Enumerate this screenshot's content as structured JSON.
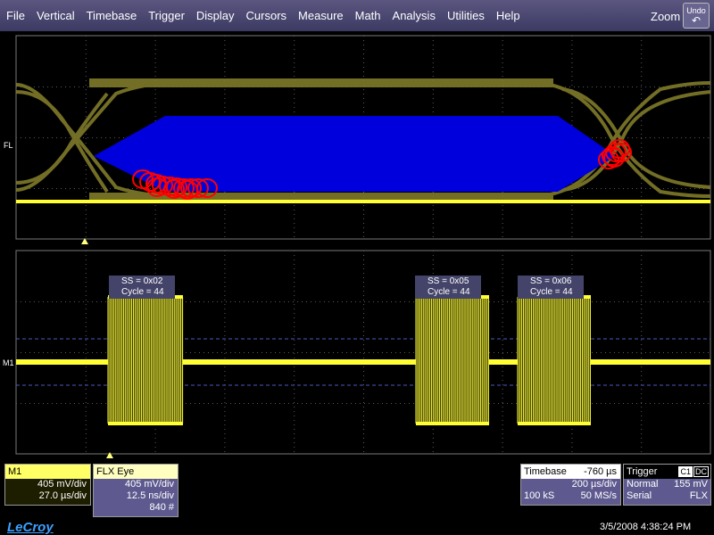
{
  "menu": [
    "File",
    "Vertical",
    "Timebase",
    "Trigger",
    "Display",
    "Cursors",
    "Measure",
    "Math",
    "Analysis",
    "Utilities",
    "Help"
  ],
  "zoom_label": "Zoom",
  "undo_label": "Undo",
  "upper_channel_label": "FL",
  "lower_channel_label": "M1",
  "annotations": [
    {
      "ss": "SS = 0x02",
      "cycle": "Cycle = 44"
    },
    {
      "ss": "SS = 0x05",
      "cycle": "Cycle = 44"
    },
    {
      "ss": "SS = 0x06",
      "cycle": "Cycle = 44"
    }
  ],
  "m1": {
    "title": "M1",
    "vdiv": "405 mV/div",
    "tdiv": "27.0 µs/div"
  },
  "flx": {
    "title": "FLX Eye",
    "vdiv": "405 mV/div",
    "tdiv": "12.5 ns/div",
    "count": "840 #"
  },
  "timebase": {
    "title": "Timebase",
    "offset": "-760 µs",
    "tdiv": "200 µs/div",
    "samples": "100 kS",
    "rate": "50 MS/s"
  },
  "trigger": {
    "title": "Trigger",
    "src": "C1",
    "coupling": "DC",
    "mode": "Normal",
    "level": "155 mV",
    "type": "Serial",
    "protocol": "FLX"
  },
  "datetime": "3/5/2008 4:38:24 PM",
  "logo": "LeCroy",
  "colors": {
    "trace": "#ffff33",
    "eye": "#807a2a",
    "mask": "#0000dd",
    "violation": "#ff0000",
    "menubar": "#3c3a63"
  }
}
